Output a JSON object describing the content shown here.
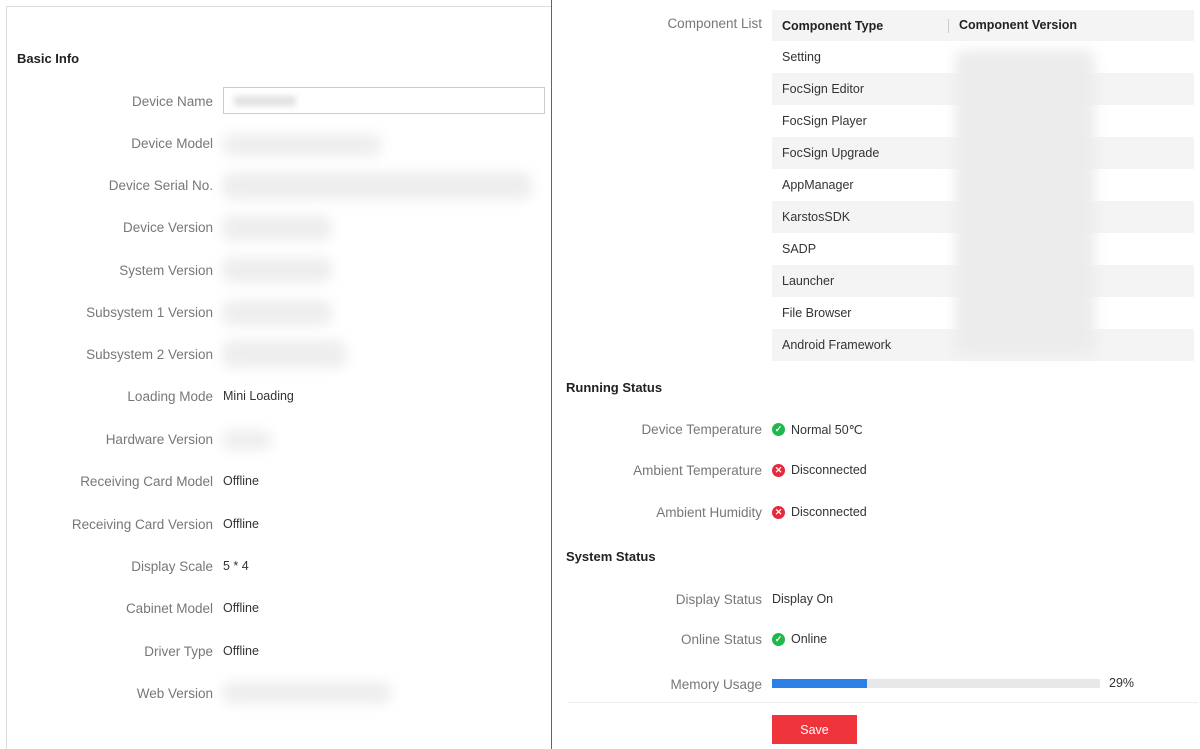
{
  "basic_info": {
    "title": "Basic Info",
    "device_name_label": "Device Name",
    "rows": [
      {
        "label": "Device Model",
        "value": ""
      },
      {
        "label": "Device Serial No.",
        "value": ""
      },
      {
        "label": "Device Version",
        "value": ""
      },
      {
        "label": "System Version",
        "value": ""
      },
      {
        "label": "Subsystem 1 Version",
        "value": ""
      },
      {
        "label": "Subsystem 2 Version",
        "value": ""
      },
      {
        "label": "Loading Mode",
        "value": "Mini Loading"
      },
      {
        "label": "Hardware Version",
        "value": ""
      },
      {
        "label": "Receiving Card Model",
        "value": "Offline"
      },
      {
        "label": "Receiving Card Version",
        "value": "Offline"
      },
      {
        "label": "Display Scale",
        "value": "5 * 4"
      },
      {
        "label": "Cabinet Model",
        "value": "Offline"
      },
      {
        "label": "Driver Type",
        "value": "Offline"
      },
      {
        "label": "Web Version",
        "value": ""
      }
    ]
  },
  "components": {
    "label": "Component List",
    "headers": [
      "Component Type",
      "Component Version"
    ],
    "rows": [
      "Setting",
      "FocSign Editor",
      "FocSign Player",
      "FocSign Upgrade",
      "AppManager",
      "KarstosSDK",
      "SADP",
      "Launcher",
      "File Browser",
      "Android Framework"
    ]
  },
  "running_status": {
    "title": "Running Status",
    "device_temperature_label": "Device Temperature",
    "device_temperature_value": "Normal 50℃",
    "ambient_temperature_label": "Ambient Temperature",
    "ambient_temperature_value": "Disconnected",
    "ambient_humidity_label": "Ambient Humidity",
    "ambient_humidity_value": "Disconnected"
  },
  "system_status": {
    "title": "System Status",
    "display_status_label": "Display Status",
    "display_status_value": "Display On",
    "online_status_label": "Online Status",
    "online_status_value": "Online",
    "memory_usage_label": "Memory Usage",
    "memory_usage_percent": 29,
    "memory_usage_text": "29%"
  },
  "actions": {
    "save_label": "Save"
  },
  "colors": {
    "accent_red": "#f0343c",
    "ok_green": "#1fb84b",
    "progress_blue": "#2c7fe6"
  }
}
